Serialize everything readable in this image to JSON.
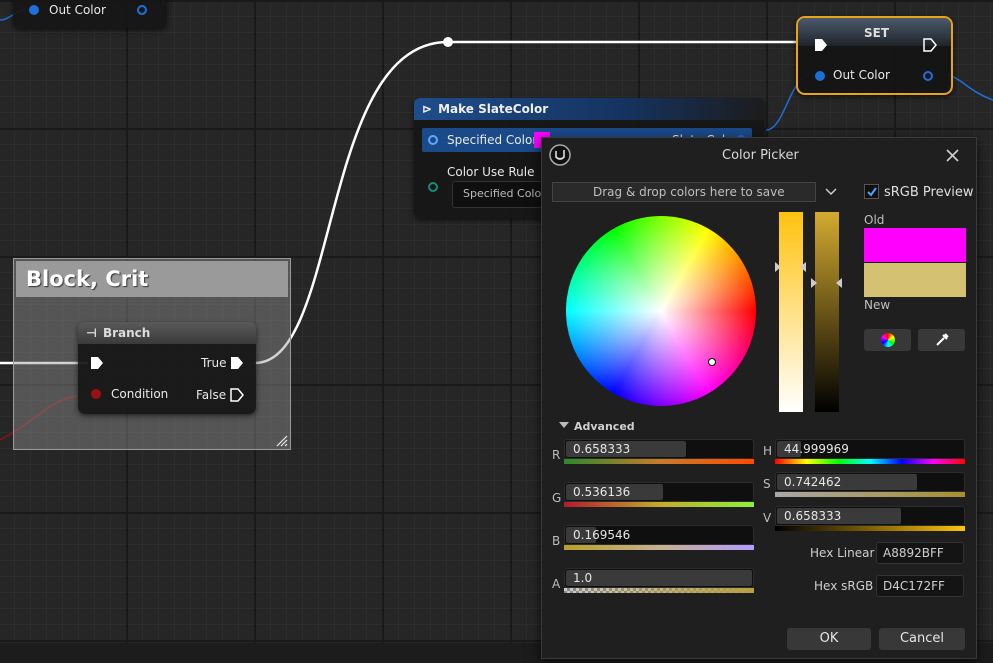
{
  "top_left_node": {
    "pin_label": "Out Color"
  },
  "set_node": {
    "title": "SET",
    "pin_label": "Out Color"
  },
  "make_node": {
    "title": "Make SlateColor",
    "specified_color_label": "Specified Color",
    "output_label": "Slate Color",
    "color_use_rule_label": "Color Use Rule",
    "color_use_rule_value": "Specified Color"
  },
  "comment_box": {
    "title": "Block, Crit"
  },
  "branch_node": {
    "title": "Branch",
    "true_label": "True",
    "false_label": "False",
    "condition_label": "Condition"
  },
  "color_picker": {
    "title": "Color Picker",
    "drop_area_label": "Drag & drop colors here to save",
    "srgb_preview_label": "sRGB Preview",
    "srgb_preview_checked": true,
    "old_label": "Old",
    "new_label": "New",
    "old_color": "#FF00FF",
    "new_color": "#D4C172",
    "advanced_label": "Advanced",
    "channels": {
      "r": {
        "label": "R",
        "value": "0.658333"
      },
      "g": {
        "label": "G",
        "value": "0.536136"
      },
      "b": {
        "label": "B",
        "value": "0.169546"
      },
      "a": {
        "label": "A",
        "value": "1.0"
      },
      "h": {
        "label": "H",
        "value": "44.999969"
      },
      "s": {
        "label": "S",
        "value": "0.742462"
      },
      "v": {
        "label": "V",
        "value": "0.658333"
      }
    },
    "hex_linear_label": "Hex Linear",
    "hex_linear_value": "A8892BFF",
    "hex_srgb_label": "Hex sRGB",
    "hex_srgb_value": "D4C172FF",
    "ok_label": "OK",
    "cancel_label": "Cancel"
  },
  "colors": {
    "set_node_border": "#E8A317",
    "exec_wire": "#FFFFFF",
    "struct_pin": "#1E6FD9",
    "bool_pin": "#9B1010"
  }
}
